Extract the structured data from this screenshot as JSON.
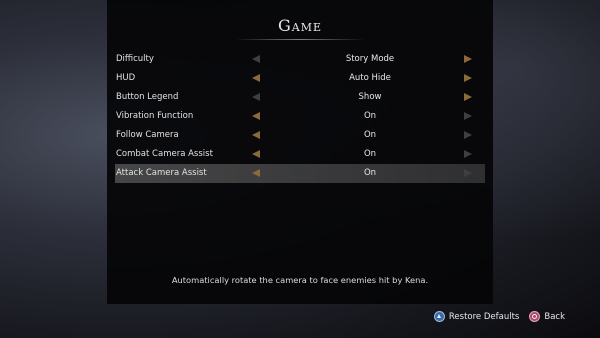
{
  "title": "Game",
  "settings": [
    {
      "label": "Difficulty",
      "value": "Story Mode"
    },
    {
      "label": "HUD",
      "value": "Auto Hide"
    },
    {
      "label": "Button Legend",
      "value": "Show"
    },
    {
      "label": "Vibration Function",
      "value": "On"
    },
    {
      "label": "Follow Camera",
      "value": "On"
    },
    {
      "label": "Combat Camera Assist",
      "value": "On"
    },
    {
      "label": "Attack Camera Assist",
      "value": "On"
    }
  ],
  "selected_index": 6,
  "description": "Automatically rotate the camera to face enemies hit by Kena.",
  "footer": {
    "restore_label": "Restore Defaults",
    "back_label": "Back"
  },
  "colors": {
    "arrow_active": "#8a6a3a",
    "arrow_inactive": "#3f3f40",
    "selection": "#6e6e6e"
  },
  "icons": {
    "restore": "triangle-button-icon",
    "back": "circle-button-icon"
  }
}
